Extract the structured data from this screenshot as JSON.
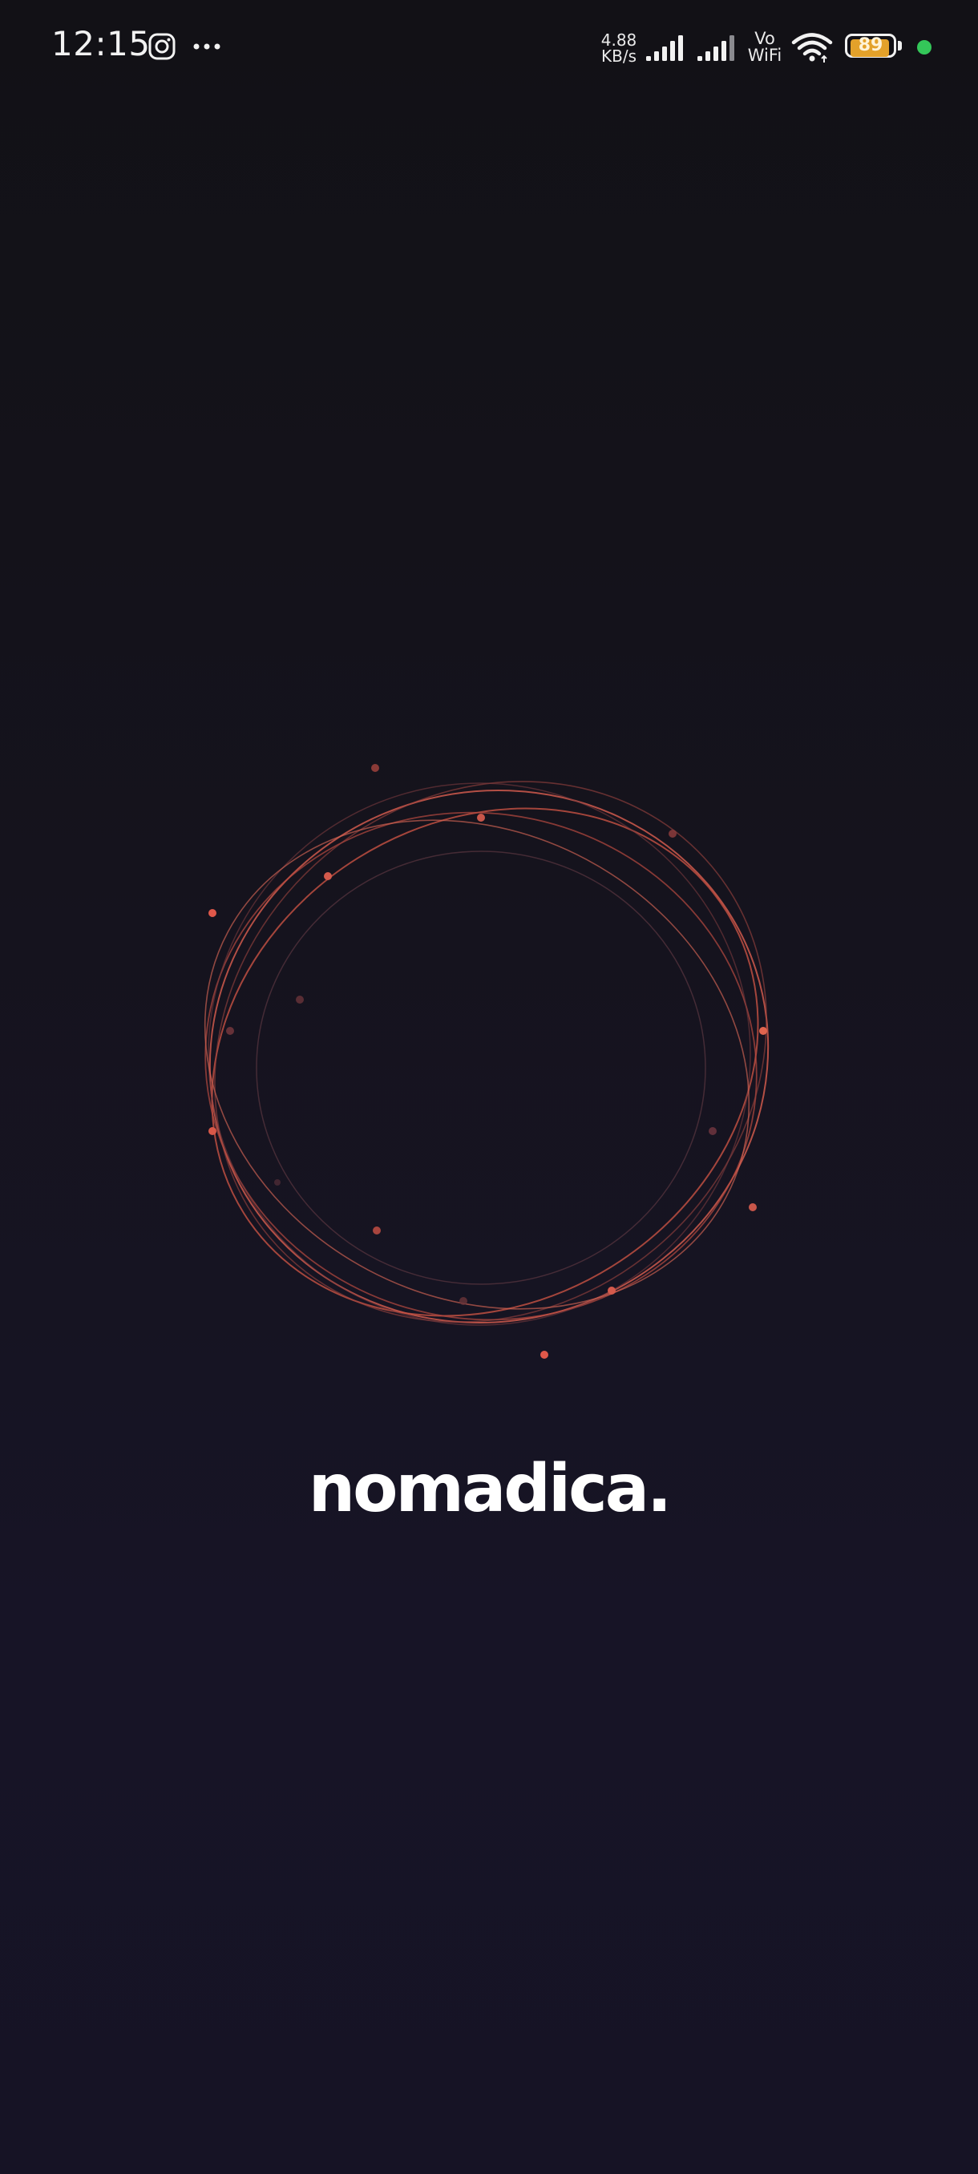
{
  "status_bar": {
    "time": "12:15",
    "network_speed_value": "4.88",
    "network_speed_unit": "KB/s",
    "vo_label": "Vo",
    "wifi_label": "WiFi",
    "battery_level": "89",
    "battery_color": "#e3a12a",
    "privacy_dot_color": "#34c759",
    "icons": [
      "instagram-icon",
      "more-icon",
      "signal-icon",
      "signal-icon",
      "wifi-icon",
      "battery-icon"
    ]
  },
  "splash": {
    "brand_name": "nomadica.",
    "accent_color": "#e0584a",
    "background_color": "#15131d"
  }
}
